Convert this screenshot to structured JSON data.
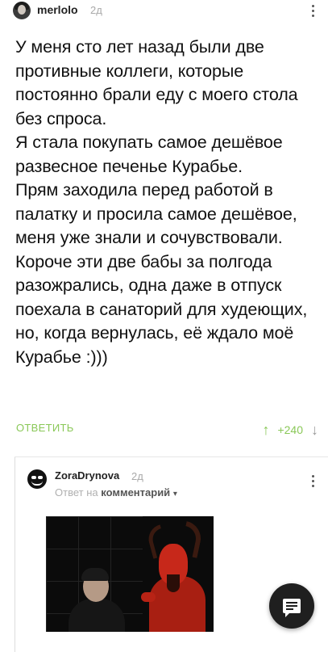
{
  "comment": {
    "author": "merlolo",
    "time": "2д",
    "paragraphs": [
      "У меня сто лет назад были две противные коллеги, которые постоянно брали еду с моего стола без спроса.",
      "Я стала покупать самое дешёвое развесное печенье Курабье.",
      "Прям заходила перед работой в палатку и просила самое дешёвое, меня уже знали и сочувствовали.",
      "Короче эти две бабы за полгода разожрались, одна даже в отпуск поехала в санаторий для худеющих, но, когда вернулась, её ждало моё Курабье :)))"
    ],
    "reply_label": "ОТВЕТИТЬ",
    "score": "+240",
    "upvote_icon": "arrow-up-icon",
    "downvote_icon": "arrow-down-icon"
  },
  "reply": {
    "author": "ZoraDrynova",
    "time": "2д",
    "reply_prefix": "Ответ на",
    "reply_link": "комментарий",
    "image_alt": "devil-meme-image"
  },
  "fab": {
    "icon": "comment-icon"
  },
  "colors": {
    "accent_green": "#8ac858",
    "muted": "#a9a9a9",
    "fab_bg": "#1f1f1f"
  }
}
